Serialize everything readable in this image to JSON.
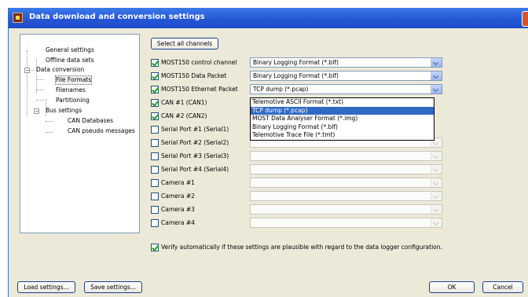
{
  "window": {
    "title": "Data download and conversion settings"
  },
  "tree": {
    "items": [
      {
        "label": "General settings"
      },
      {
        "label": "Offline data sets"
      },
      {
        "label": "Data conversion"
      },
      {
        "label": "File Formats"
      },
      {
        "label": "Filenames"
      },
      {
        "label": "Partitioning"
      },
      {
        "label": "Bus settings"
      },
      {
        "label": "CAN Databases"
      },
      {
        "label": "CAN pseudo messages"
      }
    ]
  },
  "buttons": {
    "select_all": "Select all channels",
    "load": "Load settings...",
    "save": "Save settings...",
    "ok": "OK",
    "cancel": "Cancel"
  },
  "channels": [
    {
      "label": "MOST150 control channel",
      "checked": true,
      "format": "Binary Logging Format (*.blf)"
    },
    {
      "label": "MOST150 Data Packet",
      "checked": true,
      "format": "Binary Logging Format (*.blf)"
    },
    {
      "label": "MOST150 Ethernet Packet",
      "checked": true,
      "format": "TCP dump (*.pcap)"
    },
    {
      "label": "CAN #1 (CAN1)",
      "checked": true,
      "format": ""
    },
    {
      "label": "CAN #2 (CAN2)",
      "checked": true,
      "format": ""
    },
    {
      "label": "Serial Port #1 (Serial1)",
      "checked": false,
      "format": ""
    },
    {
      "label": "Serial Port #2 (Serial2)",
      "checked": false,
      "format": ""
    },
    {
      "label": "Serial Port #3 (Serial3)",
      "checked": false,
      "format": ""
    },
    {
      "label": "Serial Port #4 (Serial4)",
      "checked": false,
      "format": ""
    },
    {
      "label": "Camera #1",
      "checked": false,
      "format": ""
    },
    {
      "label": "Camera #2",
      "checked": false,
      "format": ""
    },
    {
      "label": "Camera #3",
      "checked": false,
      "format": ""
    },
    {
      "label": "Camera #4",
      "checked": false,
      "format": ""
    }
  ],
  "dropdown": {
    "options": [
      "Telemotive ASCII Format (*.txt)",
      "TCP dump (*.pcap)",
      "MOST Data Analyser Format (*.img)",
      "Binary Logging Format (*.blf)",
      "Telemotive Trace File (*.tmt)"
    ],
    "selected_index": 1
  },
  "verify": {
    "label": "Verify automatically if these settings are plausible with regard to the data logger configuration.",
    "checked": true
  },
  "colors": {
    "titlebar": "#2456d6",
    "selection": "#316ac5",
    "dialog_bg": "#ece9d8"
  }
}
